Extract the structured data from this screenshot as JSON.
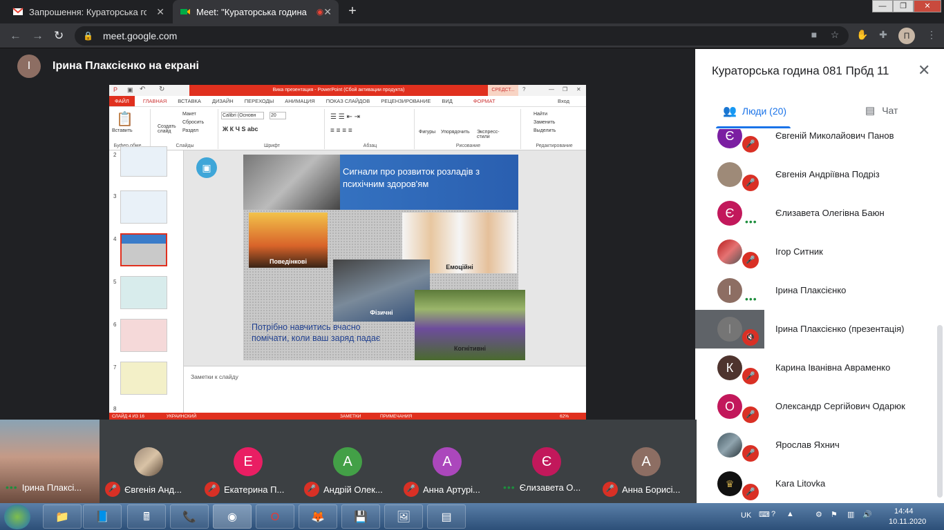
{
  "browser": {
    "tabs": [
      {
        "title": "Запрошення: Кураторська годи",
        "icon": "gmail-icon"
      },
      {
        "title": "Meet: \"Кураторська година",
        "icon": "meet-icon"
      }
    ],
    "url": "meet.google.com",
    "profile_initial": "П"
  },
  "presenter": {
    "initial": "І",
    "label": "Ірина Плаксієнко на екрані"
  },
  "powerpoint": {
    "window_title": "Вика презентация - PowerPoint (Сбой активации продукта)",
    "context_tab": "СРЕДСТ...",
    "menu": [
      "ФАЙЛ",
      "ГЛАВНАЯ",
      "ВСТАВКА",
      "ДИЗАЙН",
      "ПЕРЕХОДЫ",
      "АНИМАЦИЯ",
      "ПОКАЗ СЛАЙДОВ",
      "РЕЦЕНЗИРОВАНИЕ",
      "ВИД",
      "ФОРМАТ"
    ],
    "signin": "Вход",
    "ribbon": {
      "paste": "Вставить",
      "clipboard": "Буфер обме...",
      "new_slide": "Создать слайд",
      "layout": "Макет",
      "reset": "Сбросить",
      "section": "Раздел",
      "slides": "Слайды",
      "font_name": "Calibri (Основн",
      "font_size": "20",
      "font": "Шрифт",
      "paragraph": "Абзац",
      "shapes": "Фигуры",
      "arrange": "Упорядочить",
      "quick_styles": "Экспресс-стили",
      "drawing": "Рисование",
      "find": "Найти",
      "replace": "Заменить",
      "select": "Выделить",
      "editing": "Редактирование"
    },
    "thumb_numbers": [
      "2",
      "3",
      "4",
      "5",
      "6",
      "7",
      "8"
    ],
    "slide": {
      "title": "Сигнали про розвиток розладів з психічним здоров'ям",
      "label1": "Поведінкові",
      "label2": "Емоційні",
      "label3": "Фізичні",
      "label4": "Когнітивні",
      "body": "Потрібно навчитись вчасно помічати, коли ваш заряд падає"
    },
    "notes_placeholder": "Заметки к слайду",
    "status": {
      "slide": "СЛАЙД 4 ИЗ 16",
      "language": "УКРАИНСКИЙ",
      "notes": "ЗАМЕТКИ",
      "comments": "ПРИМЕЧАНИЯ",
      "zoom": "62%"
    }
  },
  "panel": {
    "title": "Кураторська година 081 Прбд 11",
    "tab_people": "Люди (20)",
    "tab_chat": "Чат",
    "people": [
      {
        "name": "Євгеній Миколайович Панов",
        "initial": "Є",
        "color": "#7b1fa2",
        "state": "muted"
      },
      {
        "name": "Євгенія Андріївна Подріз",
        "initial": "",
        "color": "#9e8a78",
        "state": "muted"
      },
      {
        "name": "Єлизавета Олегівна Баюн",
        "initial": "Є",
        "color": "#c2185b",
        "state": "talking"
      },
      {
        "name": "Ігор Ситник",
        "initial": "",
        "color": "#b71c1c",
        "state": "muted"
      },
      {
        "name": "Ірина Плаксієнко",
        "initial": "І",
        "color": "#8d6e63",
        "state": "talking"
      },
      {
        "name": "Ірина Плаксієнко (презентація)",
        "initial": "І",
        "color": "#757575",
        "state": "muted-presentation"
      },
      {
        "name": "Карина Іванівна Авраменко",
        "initial": "К",
        "color": "#4e342e",
        "state": "muted"
      },
      {
        "name": "Олександр Сергійович Одарюк",
        "initial": "О",
        "color": "#c2185b",
        "state": "muted"
      },
      {
        "name": "Ярослав Яхнич",
        "initial": "",
        "color": "#455a64",
        "state": "muted"
      },
      {
        "name": "Kara Litovka",
        "initial": "",
        "color": "#111111",
        "state": "muted"
      }
    ]
  },
  "filmstrip": [
    {
      "name": "Ірина Плаксі...",
      "initial": "",
      "color": "",
      "state": "talking"
    },
    {
      "name": "Євгенія Анд...",
      "initial": "",
      "color": "#9e8a78",
      "state": "muted"
    },
    {
      "name": "Екатерина П...",
      "initial": "Е",
      "color": "#e91e63",
      "state": "muted"
    },
    {
      "name": "Андрій Олек...",
      "initial": "А",
      "color": "#43a047",
      "state": "muted"
    },
    {
      "name": "Анна Артурі...",
      "initial": "А",
      "color": "#ab47bc",
      "state": "muted"
    },
    {
      "name": "Єлизавета О...",
      "initial": "Є",
      "color": "#c2185b",
      "state": "talking"
    },
    {
      "name": "Анна Борисі...",
      "initial": "А",
      "color": "#8d6e63",
      "state": "muted"
    }
  ],
  "taskbar": {
    "lang": "UK",
    "time": "14:44",
    "date": "10.11.2020"
  }
}
